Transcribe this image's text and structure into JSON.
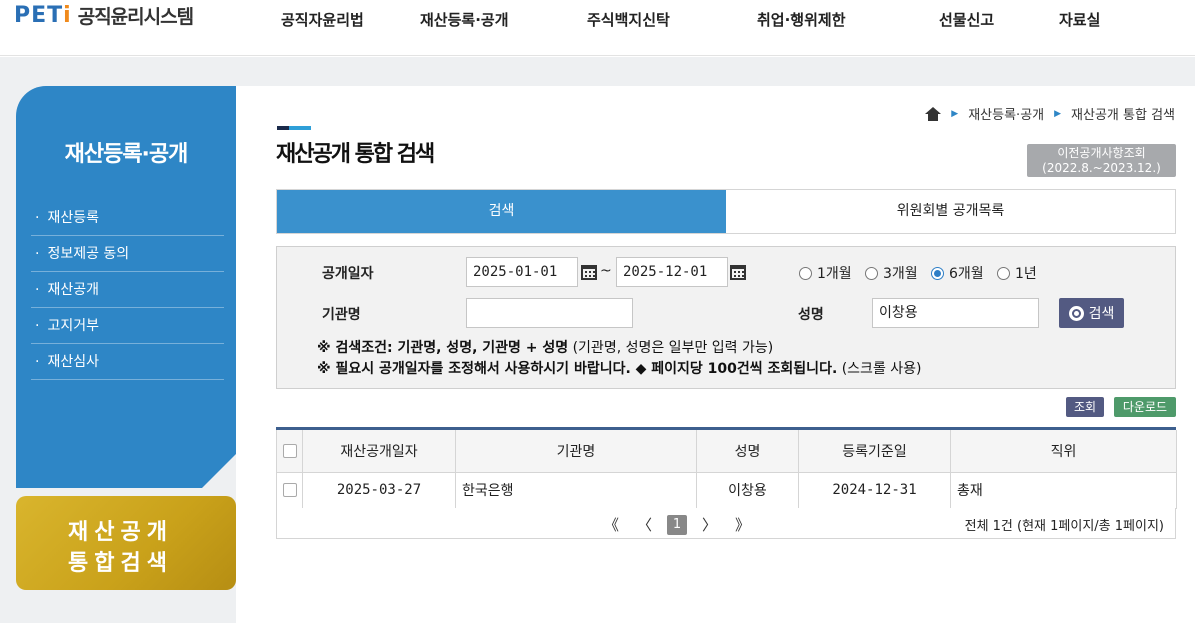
{
  "header": {
    "logo_peti": "PET",
    "logo_i": "i",
    "logo_name": "공직윤리시스템",
    "nav": [
      "공직자윤리법",
      "재산등록·공개",
      "주식백지신탁",
      "취업·행위제한",
      "선물신고",
      "자료실"
    ]
  },
  "sidebar": {
    "title": "재산등록·공개",
    "bullet": "·",
    "items": [
      "재산등록",
      "정보제공 동의",
      "재산공개",
      "고지거부",
      "재산심사"
    ],
    "banner": {
      "line1": "재산공개",
      "line2": "통합검색"
    }
  },
  "breadcrumb": {
    "items": [
      "재산등록·공개",
      "재산공개 통합 검색"
    ],
    "separator": "▶"
  },
  "page": {
    "title": "재산공개 통합 검색",
    "prev_button_line1": "이전공개사항조회",
    "prev_button_line2": "(2022.8.~2023.12.)"
  },
  "tabs": [
    {
      "label": "검색",
      "active": true
    },
    {
      "label": "위원회별 공개목록",
      "active": false
    }
  ],
  "search": {
    "date_label": "공개일자",
    "date_from": "2025-01-01",
    "date_to": "2025-12-01",
    "date_separator": "~",
    "periods": [
      {
        "label": "1개월",
        "selected": false
      },
      {
        "label": "3개월",
        "selected": false
      },
      {
        "label": "6개월",
        "selected": true
      },
      {
        "label": "1년",
        "selected": false
      }
    ],
    "org_label": "기관명",
    "org_value": "",
    "name_label": "성명",
    "name_value": "이창용",
    "search_button": "검색",
    "notice1_bold": "※ 검색조건: 기관명, 성명, 기관명 + 성명",
    "notice1_rest": " (기관명, 성명은 일부만 입력 가능)",
    "notice2_bold": "※ 필요시 공개일자를 조정해서 사용하시기 바랍니다. ◆ 페이지당 100건씩 조회됩니다.",
    "notice2_rest": " (스크롤 사용)"
  },
  "actions": {
    "query": "조회",
    "download": "다운로드"
  },
  "table": {
    "columns": [
      "재산공개일자",
      "기관명",
      "성명",
      "등록기준일",
      "직위"
    ],
    "rows": [
      {
        "date": "2025-03-27",
        "org": "한국은행",
        "name": "이창용",
        "base_date": "2024-12-31",
        "position": "총재"
      }
    ]
  },
  "pagination": {
    "first": "《",
    "prev": "〈",
    "current": "1",
    "next": "〉",
    "last": "》",
    "total": "전체 1건 (현재 1페이지/총 1페이지)"
  },
  "colors": {
    "primary_blue": "#3a91cd",
    "sidebar_blue": "#2e86c6",
    "button_navy": "#535a82",
    "download_green": "#4e9a6a",
    "banner_gold": "#d9b52d"
  }
}
